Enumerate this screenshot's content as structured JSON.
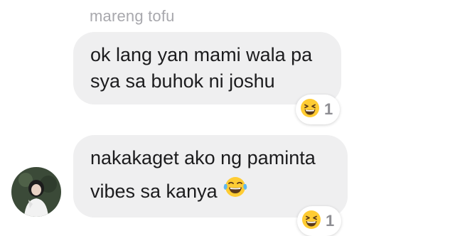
{
  "sender": {
    "name": "mareng tofu"
  },
  "messages": [
    {
      "lines": [
        "ok lang yan mami wala pa",
        "sya sa buhok ni joshu"
      ],
      "reaction": {
        "emoji": "grinning-squinting-face",
        "count": "1"
      }
    },
    {
      "lines": [
        "nakakaget ako ng paminta",
        "vibes sa kanya"
      ],
      "inline_emoji": "face-with-tears-of-joy",
      "reaction": {
        "emoji": "grinning-squinting-face",
        "count": "1"
      }
    }
  ],
  "colors": {
    "bubble": "#efeff0",
    "sender_name": "#a8a8ad",
    "text": "#1c1c1e",
    "reaction_count": "#8e8e93",
    "avatar_bg": "#3b4a38"
  }
}
